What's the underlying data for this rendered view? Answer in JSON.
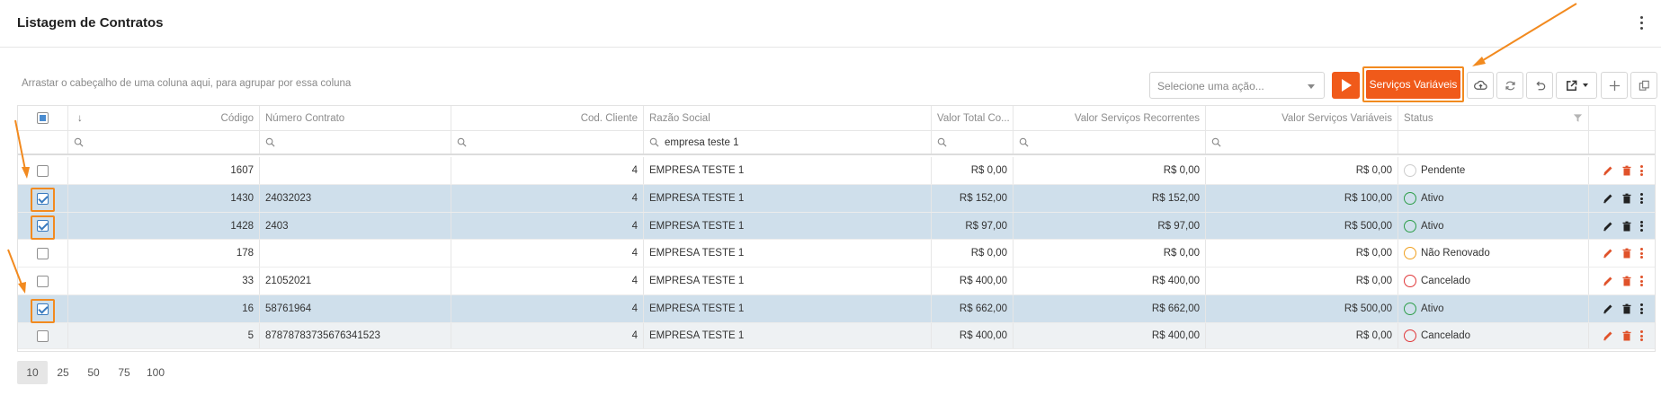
{
  "header": {
    "title": "Listagem de Contratos"
  },
  "grid_hint": "Arrastar o cabeçalho de uma coluna aqui, para agrupar por essa coluna",
  "toolbar": {
    "select_placeholder": "Selecione uma ação...",
    "variable_services_label": "Serviços Variáveis"
  },
  "columns": {
    "sort": "↓",
    "code": "Código",
    "contract_number": "Número Contrato",
    "client_code": "Cod. Cliente",
    "company_name": "Razão Social",
    "total_value": "Valor Total Co...",
    "recurring_value": "Valor Serviços Recorrentes",
    "variable_value": "Valor Serviços Variáveis",
    "status": "Status"
  },
  "filters": {
    "company_name": "empresa teste 1"
  },
  "rows": [
    {
      "code": "1607",
      "contract": "",
      "client": "4",
      "company": "EMPRESA TESTE 1",
      "total": "R$ 0,00",
      "recurring": "R$ 0,00",
      "variable": "R$ 0,00",
      "status": "Pendente",
      "selected": false
    },
    {
      "code": "1430",
      "contract": "24032023",
      "client": "4",
      "company": "EMPRESA TESTE 1",
      "total": "R$ 152,00",
      "recurring": "R$ 152,00",
      "variable": "R$ 100,00",
      "status": "Ativo",
      "selected": true
    },
    {
      "code": "1428",
      "contract": "2403",
      "client": "4",
      "company": "EMPRESA TESTE 1",
      "total": "R$ 97,00",
      "recurring": "R$ 97,00",
      "variable": "R$ 500,00",
      "status": "Ativo",
      "selected": true
    },
    {
      "code": "178",
      "contract": "",
      "client": "4",
      "company": "EMPRESA TESTE 1",
      "total": "R$ 0,00",
      "recurring": "R$ 0,00",
      "variable": "R$ 0,00",
      "status": "Não Renovado",
      "selected": false
    },
    {
      "code": "33",
      "contract": "21052021",
      "client": "4",
      "company": "EMPRESA TESTE 1",
      "total": "R$ 400,00",
      "recurring": "R$ 400,00",
      "variable": "R$ 0,00",
      "status": "Cancelado",
      "selected": false
    },
    {
      "code": "16",
      "contract": "58761964",
      "client": "4",
      "company": "EMPRESA TESTE 1",
      "total": "R$ 662,00",
      "recurring": "R$ 662,00",
      "variable": "R$ 500,00",
      "status": "Ativo",
      "selected": true
    },
    {
      "code": "5",
      "contract": "87878783735676341523",
      "client": "4",
      "company": "EMPRESA TESTE 1",
      "total": "R$ 400,00",
      "recurring": "R$ 400,00",
      "variable": "R$ 0,00",
      "status": "Cancelado",
      "selected": false
    }
  ],
  "status_colors": {
    "Pendente": "#cccccc",
    "Ativo": "#2e9e4a",
    "Não Renovado": "#f0a020",
    "Cancelado": "#e0383a"
  },
  "colors": {
    "accent": "#f05a1a",
    "highlight": "#f28a1f",
    "selected_row": "#cfdfeb",
    "edit_icon_normal": "#e0522a",
    "edit_icon_selected": "#222222"
  },
  "pager": {
    "sizes": [
      "10",
      "25",
      "50",
      "75",
      "100"
    ],
    "active": "10"
  },
  "icons": [
    "kebab-icon",
    "play-icon",
    "cloud-upload-icon",
    "refresh-icon",
    "undo-icon",
    "export-icon",
    "plus-icon",
    "copy-icon",
    "search-icon",
    "filter-icon",
    "pencil-icon",
    "trash-icon"
  ]
}
